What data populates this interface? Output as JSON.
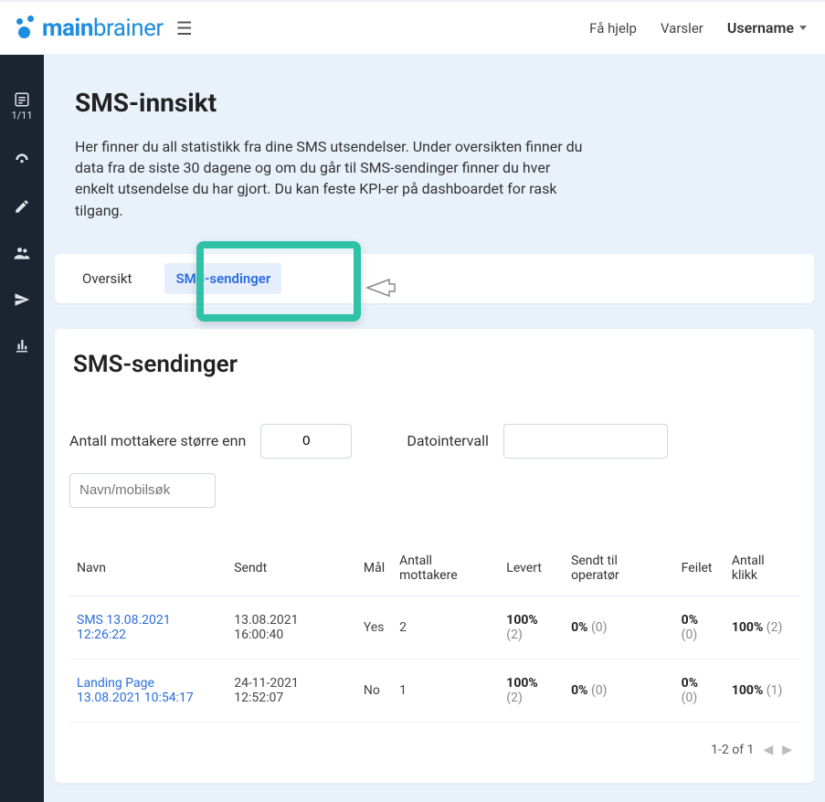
{
  "brand": {
    "name_bold": "main",
    "name_light": "brainer"
  },
  "topnav": {
    "help": "Få hjelp",
    "alerts": "Varsler",
    "username": "Username"
  },
  "sidebar": {
    "step": "1/11"
  },
  "intro": {
    "title": "SMS-innsikt",
    "desc": "Her finner du all statistikk fra dine SMS utsendelser. Under oversikten finner du data fra de siste 30 dagene og om du går til SMS-sendinger finner du hver enkelt utsendelse du har gjort. Du kan feste KPI-er på dashboardet for rask tilgang."
  },
  "tabs": {
    "overview": "Oversikt",
    "sendings": "SMS-sendinger"
  },
  "panel": {
    "title": "SMS-sendinger"
  },
  "filters": {
    "recipients_gt_label": "Antall mottakere større enn",
    "recipients_gt_value": "0",
    "daterange_label": "Datointervall",
    "daterange_value": "",
    "search_placeholder": "Navn/mobilsøk"
  },
  "columns": {
    "name": "Navn",
    "sent": "Sendt",
    "goal": "Mål",
    "recipients": "Antall mottakere",
    "delivered": "Levert",
    "to_operator": "Sendt til operatør",
    "failed": "Feilet",
    "clicks": "Antall klikk"
  },
  "rows": [
    {
      "name": "SMS 13.08.2021 12:26:22",
      "sent": "13.08.2021 16:00:40",
      "goal": "Yes",
      "recipients": "2",
      "delivered_pct": "100%",
      "delivered_n": "(2)",
      "to_op_pct": "0%",
      "to_op_n": "(0)",
      "failed_pct": "0%",
      "failed_n": "(0)",
      "clicks_pct": "100%",
      "clicks_n": "(2)"
    },
    {
      "name": "Landing Page 13.08.2021 10:54:17",
      "sent": "24-11-2021 12:52:07",
      "goal": "No",
      "recipients": "1",
      "delivered_pct": "100%",
      "delivered_n": "(2)",
      "to_op_pct": "0%",
      "to_op_n": "(0)",
      "failed_pct": "0%",
      "failed_n": "(0)",
      "clicks_pct": "100%",
      "clicks_n": "(1)"
    }
  ],
  "pager": {
    "label": "1-2 of 1"
  }
}
